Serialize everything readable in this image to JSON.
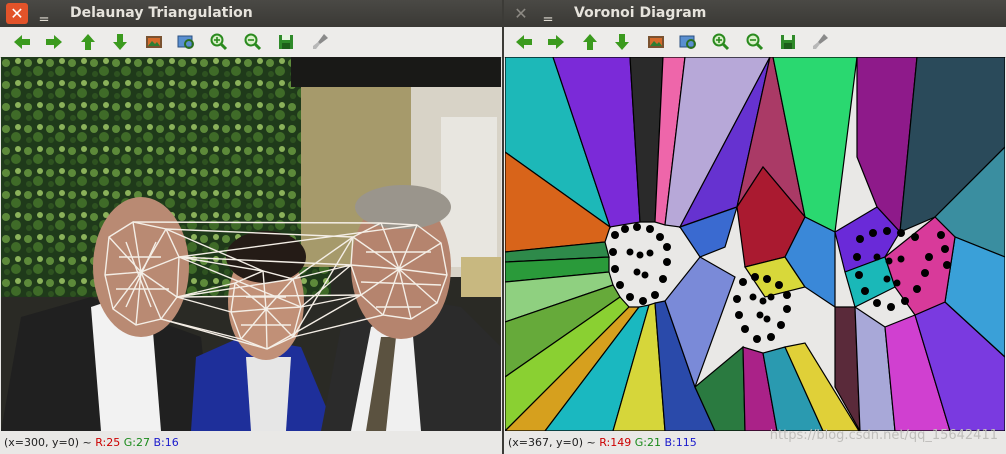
{
  "left_window": {
    "title": "Delaunay Triangulation",
    "close_glyph": "✕",
    "minimize_glyph": "‗",
    "toolbar_icons": [
      "arrow-left-icon",
      "arrow-right-icon",
      "arrow-up-icon",
      "arrow-down-icon",
      "image-icon",
      "zoom-fit-icon",
      "zoom-in-icon",
      "zoom-out-icon",
      "save-icon",
      "brush-icon"
    ],
    "status": {
      "coords": "(x=300, y=0) ~ ",
      "r": "R:25",
      "g": "G:27",
      "b": "B:16"
    }
  },
  "right_window": {
    "title": "Voronoi Diagram",
    "close_glyph": "✕",
    "minimize_glyph": "‗",
    "toolbar_icons": [
      "arrow-left-icon",
      "arrow-right-icon",
      "arrow-up-icon",
      "arrow-down-icon",
      "image-icon",
      "zoom-fit-icon",
      "zoom-in-icon",
      "zoom-out-icon",
      "save-icon",
      "brush-icon"
    ],
    "status": {
      "coords": "(x=367, y=0) ~ ",
      "r": "R:149",
      "g": "G:21",
      "b": "B:115"
    },
    "watermark": "https://blog.csdn.net/qq_15642411"
  },
  "colors": {
    "close_active": "#e2532a",
    "toolbar_arrow": "#3b9a1e",
    "status_r": "#cc0000",
    "status_g": "#1a8a1a",
    "status_b": "#1a1acc"
  }
}
